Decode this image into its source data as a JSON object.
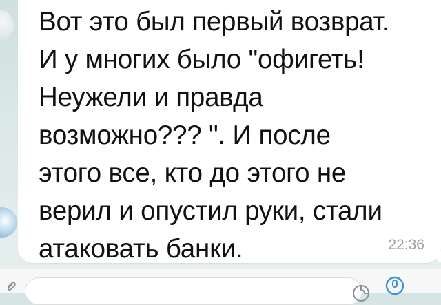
{
  "message": {
    "text": "Вот это был первый возврат.\nИ у многих было \"офигеть!\nНеужели и правда\nвозможно??? \". И после\nэтого все, кто до этого не\nверил и опустил руки, стали\nатаковать банки.",
    "time": "22:36"
  },
  "colors": {
    "bubble": "#ffffff",
    "chat_background": "#d7e4e4",
    "timestamp": "#9aa3a6",
    "accent": "#3a8fe0"
  },
  "icons": {
    "attach": "paperclip-icon",
    "sticker": "sticker-icon",
    "mic": "mic-icon"
  }
}
